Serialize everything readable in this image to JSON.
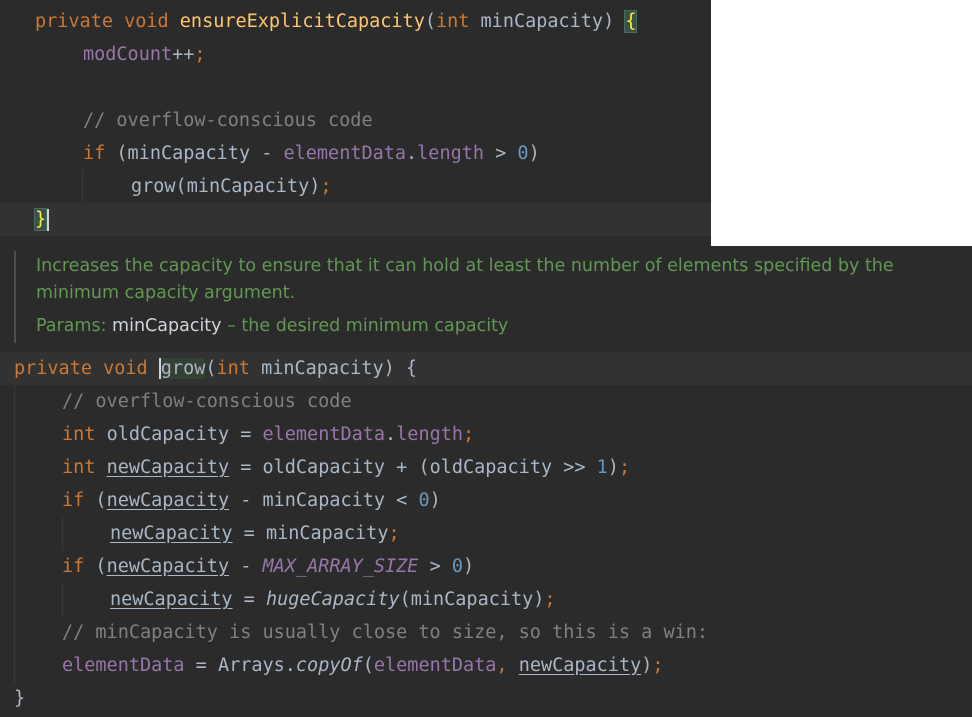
{
  "top_code": {
    "lines": [
      {
        "parts": [
          [
            "kw",
            "private void "
          ],
          [
            "fn",
            "ensureExplicitCapacity"
          ],
          [
            "plain",
            "("
          ],
          [
            "kw",
            "int "
          ],
          [
            "plain",
            "minCapacity) "
          ]
        ],
        "brace": "{"
      },
      {
        "parts": [
          [
            "field",
            "modCount"
          ],
          [
            "plain",
            "++"
          ],
          [
            "semi",
            ";"
          ]
        ]
      },
      {
        "parts": []
      },
      {
        "parts": [
          [
            "cmt",
            "// overflow-conscious code"
          ]
        ]
      },
      {
        "parts": [
          [
            "kw",
            "if "
          ],
          [
            "plain",
            "(minCapacity - "
          ],
          [
            "field",
            "elementData"
          ],
          [
            "plain",
            "."
          ],
          [
            "field",
            "length"
          ],
          [
            "plain",
            " > "
          ],
          [
            "num",
            "0"
          ],
          [
            "plain",
            ")"
          ]
        ]
      },
      {
        "parts": [
          [
            "plain",
            "grow(minCapacity)"
          ],
          [
            "semi",
            ";"
          ]
        ]
      },
      {
        "parts": [],
        "brace": "}"
      }
    ]
  },
  "doc": {
    "line1": "Increases the capacity to ensure that it can hold at least the number of elements specified by the",
    "line2": "minimum capacity argument.",
    "params_label": "Params: ",
    "param_name": "minCapacity",
    "param_desc": " – the desired minimum capacity"
  },
  "bottom_code": {
    "lines": [
      {
        "parts": [
          [
            "kw",
            "private void "
          ],
          [
            "gro",
            "grow"
          ],
          [
            "plain",
            "("
          ],
          [
            "kw",
            "int "
          ],
          [
            "plain",
            "minCapacity) {"
          ]
        ]
      },
      {
        "parts": [
          [
            "cmt",
            "// overflow-conscious code"
          ]
        ]
      },
      {
        "parts": [
          [
            "kw",
            "int "
          ],
          [
            "plain",
            "oldCapacity = "
          ],
          [
            "field",
            "elementData"
          ],
          [
            "plain",
            "."
          ],
          [
            "field",
            "length"
          ],
          [
            "semi",
            ";"
          ]
        ]
      },
      {
        "parts": [
          [
            "kw",
            "int "
          ],
          [
            "ul",
            "newCapacity"
          ],
          [
            "plain",
            " = oldCapacity + (oldCapacity >> "
          ],
          [
            "num",
            "1"
          ],
          [
            "plain",
            ")"
          ],
          [
            "semi",
            ";"
          ]
        ]
      },
      {
        "parts": [
          [
            "kw",
            "if "
          ],
          [
            "plain",
            "("
          ],
          [
            "ul",
            "newCapacity"
          ],
          [
            "plain",
            " - minCapacity < "
          ],
          [
            "num",
            "0"
          ],
          [
            "plain",
            ")"
          ]
        ]
      },
      {
        "parts": [
          [
            "ul",
            "newCapacity"
          ],
          [
            "plain",
            " = minCapacity"
          ],
          [
            "semi",
            ";"
          ]
        ]
      },
      {
        "parts": [
          [
            "kw",
            "if "
          ],
          [
            "plain",
            "("
          ],
          [
            "ul",
            "newCapacity"
          ],
          [
            "plain",
            " - "
          ],
          [
            "const",
            "MAX_ARRAY_SIZE"
          ],
          [
            "plain",
            " > "
          ],
          [
            "num",
            "0"
          ],
          [
            "plain",
            ")"
          ]
        ]
      },
      {
        "parts": [
          [
            "ul",
            "newCapacity"
          ],
          [
            "plain",
            " = "
          ],
          [
            "static",
            "hugeCapacity"
          ],
          [
            "plain",
            "(minCapacity)"
          ],
          [
            "semi",
            ";"
          ]
        ]
      },
      {
        "parts": [
          [
            "cmt",
            "// minCapacity is usually close to size, so this is a win:"
          ]
        ]
      },
      {
        "parts": [
          [
            "field",
            "elementData"
          ],
          [
            "plain",
            " = Arrays."
          ],
          [
            "static",
            "copyOf"
          ],
          [
            "plain",
            "("
          ],
          [
            "field",
            "elementData"
          ],
          [
            "semi",
            ", "
          ],
          [
            "ul",
            "newCapacity"
          ],
          [
            "plain",
            ")"
          ],
          [
            "semi",
            ";"
          ]
        ]
      },
      {
        "parts": [
          [
            "plain",
            "}"
          ]
        ]
      }
    ]
  },
  "colors": {
    "background": "#2b2b2b",
    "keyword": "#cc7832",
    "method": "#ffc66d",
    "field": "#9876aa",
    "number": "#6897bb",
    "comment": "#808080",
    "doc": "#629755",
    "text": "#a9b7c6"
  }
}
